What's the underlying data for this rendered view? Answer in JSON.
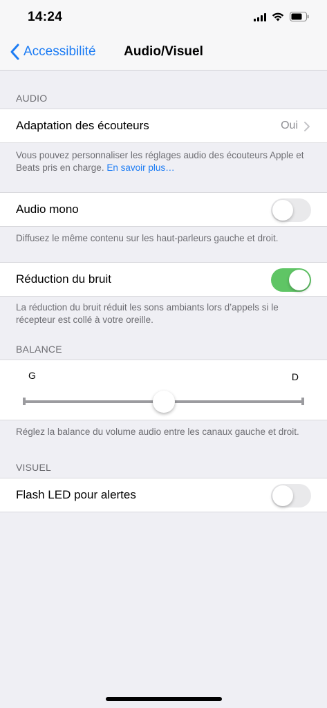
{
  "status_bar": {
    "time": "14:24"
  },
  "nav": {
    "back_label": "Accessibilité",
    "title": "Audio/Visuel"
  },
  "audio": {
    "header": "AUDIO",
    "headphone_row": {
      "label": "Adaptation des écouteurs",
      "value": "Oui"
    },
    "headphone_footer": "Vous pouvez personnaliser les réglages audio des écouteurs Apple et Beats pris en charge.",
    "headphone_link": "En savoir plus…",
    "mono_row": {
      "label": "Audio mono",
      "enabled": false
    },
    "mono_footer": "Diffusez le même contenu sur les haut-parleurs gauche et droit.",
    "noise_row": {
      "label": "Réduction du bruit",
      "enabled": true
    },
    "noise_footer": "La réduction du bruit réduit les sons ambiants lors d’appels si le récepteur est collé à votre oreille."
  },
  "balance": {
    "header": "BALANCE",
    "left_label": "G",
    "right_label": "D",
    "level": 0.5,
    "footer": "Réglez la balance du volume audio entre les canaux gauche et droit."
  },
  "visual": {
    "header": "VISUEL",
    "flash_row": {
      "label": "Flash LED pour alertes",
      "enabled": false
    }
  },
  "colors": {
    "accent": "#1c7cf4",
    "switch_on": "#5fc565",
    "background": "#efeff4"
  }
}
